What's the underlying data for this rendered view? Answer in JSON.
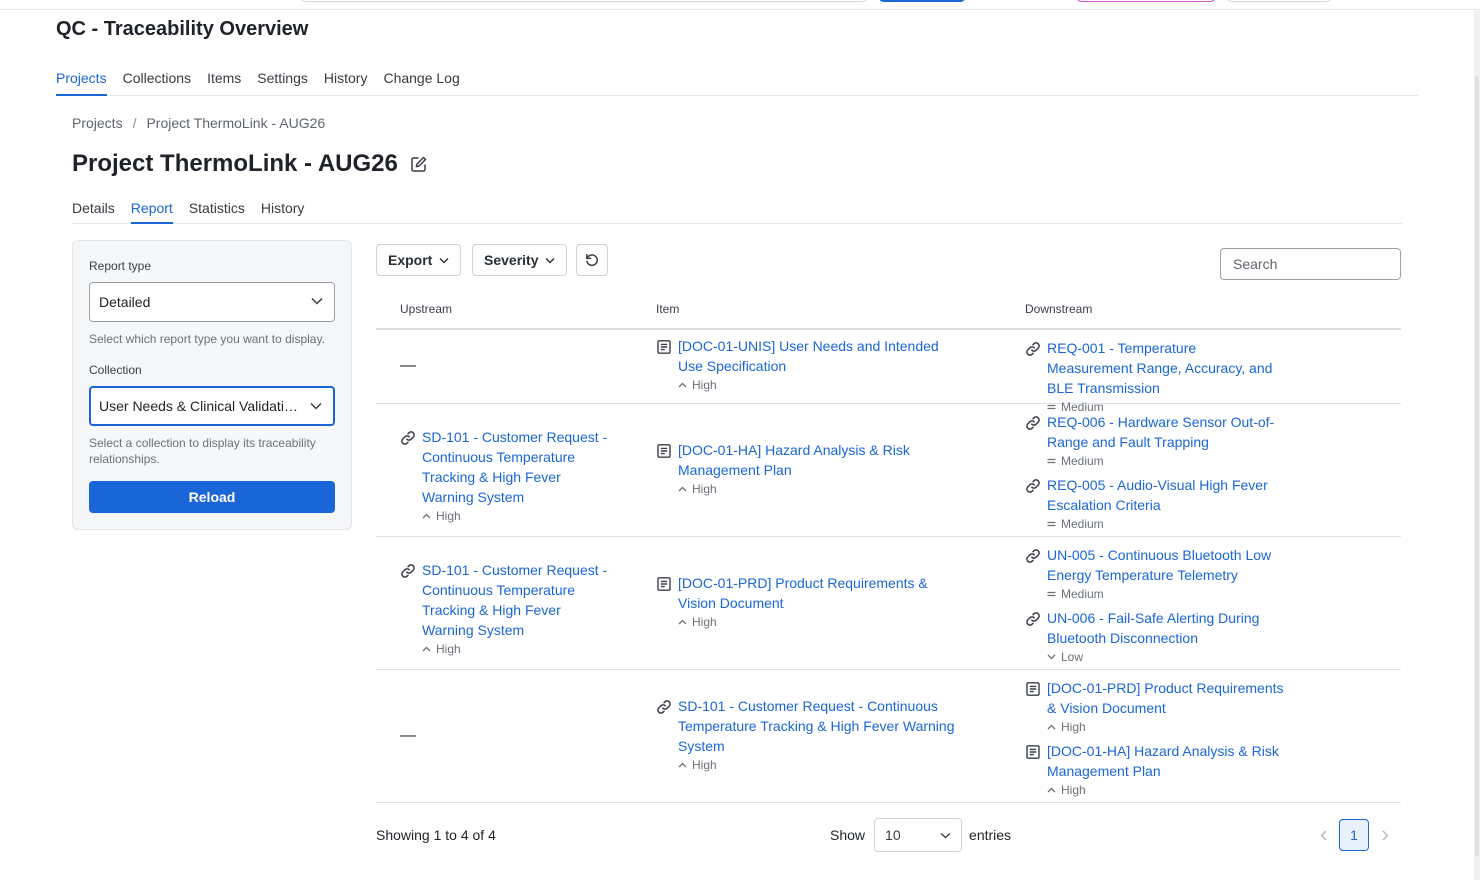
{
  "app": {
    "title": "QC - Traceability Overview"
  },
  "main_tabs": [
    {
      "label": "Projects",
      "active": true
    },
    {
      "label": "Collections"
    },
    {
      "label": "Items"
    },
    {
      "label": "Settings"
    },
    {
      "label": "History"
    },
    {
      "label": "Change Log"
    }
  ],
  "breadcrumb": {
    "root": "Projects",
    "separator": "/",
    "current": "Project ThermoLink - AUG26"
  },
  "page": {
    "title": "Project ThermoLink - AUG26"
  },
  "sub_tabs": [
    {
      "label": "Details"
    },
    {
      "label": "Report",
      "active": true
    },
    {
      "label": "Statistics"
    },
    {
      "label": "History"
    }
  ],
  "report_panel": {
    "report_type_label": "Report type",
    "report_type_value": "Detailed",
    "report_type_help": "Select which report type you want to display.",
    "collection_label": "Collection",
    "collection_value": "User Needs & Clinical Validation",
    "collection_help": "Select a collection to display its traceability relationships.",
    "reload_label": "Reload"
  },
  "toolbar": {
    "export_label": "Export",
    "severity_label": "Severity",
    "search_placeholder": "Search"
  },
  "table": {
    "headers": {
      "upstream": "Upstream",
      "item": "Item",
      "downstream": "Downstream"
    },
    "empty_marker": "—",
    "rows": [
      {
        "upstream_text": "—",
        "item": {
          "icon": "document-icon",
          "title": "[DOC-01-UNIS] User Needs and Intended Use Specification",
          "severity": "High"
        },
        "downstream": [
          {
            "icon": "link-icon",
            "title": "REQ-001 - Temperature Measurement Range, Accuracy, and BLE Transmission",
            "severity": "Medium"
          }
        ]
      },
      {
        "upstream": [
          {
            "icon": "link-icon",
            "title": "SD-101 - Customer Request - Continuous Temperature Tracking & High Fever Warning System",
            "severity": "High"
          }
        ],
        "item": {
          "icon": "document-icon",
          "title": "[DOC-01-HA] Hazard Analysis & Risk Management Plan",
          "severity": "High"
        },
        "downstream": [
          {
            "icon": "link-icon",
            "title": "REQ-006 - Hardware Sensor Out-of-Range and Fault Trapping",
            "severity": "Medium"
          },
          {
            "icon": "link-icon",
            "title": "REQ-005 - Audio-Visual High Fever Escalation Criteria",
            "severity": "Medium"
          }
        ]
      },
      {
        "upstream": [
          {
            "icon": "link-icon",
            "title": "SD-101 - Customer Request - Continuous Temperature Tracking & High Fever Warning System",
            "severity": "High"
          }
        ],
        "item": {
          "icon": "document-icon",
          "title": "[DOC-01-PRD] Product Requirements & Vision Document",
          "severity": "High"
        },
        "downstream": [
          {
            "icon": "link-icon",
            "title": "UN-005 - Continuous Bluetooth Low Energy Temperature Telemetry",
            "severity": "Medium"
          },
          {
            "icon": "link-icon",
            "title": "UN-006 - Fail-Safe Alerting During Bluetooth Disconnection",
            "severity": "Low"
          }
        ]
      },
      {
        "upstream_text": "—",
        "item": {
          "icon": "link-icon",
          "title": "SD-101 - Customer Request - Continuous Temperature Tracking & High Fever Warning System",
          "severity": "High"
        },
        "downstream": [
          {
            "icon": "document-icon",
            "title": "[DOC-01-PRD] Product Requirements & Vision Document",
            "severity": "High"
          },
          {
            "icon": "document-icon",
            "title": "[DOC-01-HA] Hazard Analysis & Risk Management Plan",
            "severity": "High"
          }
        ]
      }
    ]
  },
  "footer": {
    "showing_text": "Showing 1 to 4 of 4",
    "show_label": "Show",
    "page_size": "10",
    "entries_label": "entries",
    "current_page": "1"
  },
  "colors": {
    "accent": "#1a66d8",
    "text": "#212529",
    "muted": "#6b7178"
  }
}
